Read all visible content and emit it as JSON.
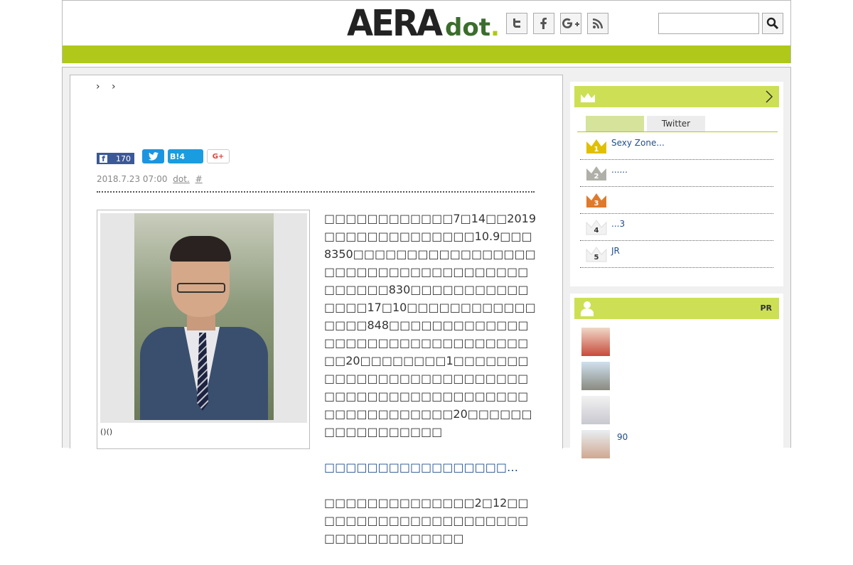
{
  "header": {
    "logo_main": "AERA",
    "logo_sub": "dot",
    "logo_period": ".",
    "sns": [
      "twitter-icon",
      "facebook-icon",
      "google-plus-icon",
      "rss-icon"
    ],
    "search_placeholder": ""
  },
  "article": {
    "breadcrumb": "› ›",
    "share": {
      "fb_count": "170",
      "hb_label": "B!",
      "hb_count": "4",
      "gp_label": "G+"
    },
    "date": "2018.7.23 07:00",
    "author": "dot.",
    "hash": "#",
    "photo_caption": "()()",
    "paragraphs": [
      "□□□□□□□□□□□□7□14□□2019□□□□□□□□□□□□□□10.9□□□8350□□□□□□□□□□□□□□□□□□□□□□□□□□□□□□□□□□□□□□□□□□830□□□□□□□□□□□□□□□17□10□□□□□□□□□□□□□□□□848□□□□□□□□□□□□□□□□□□□□□□□□□□□□□□□□□□20□□□□□□□□1□□□□□□□□□□□□□□□□□□□□□□□□□□□□□□□□□□□□□□□□□□□□□□□□□□□□□□□□□20□□□□□□□□□□□□□□□□□",
      "□□□□□□□□□□□□□□□□□…",
      "□□□□□□□□□□□□□□2□12□□□□□□□□□□□□□□□□□□□□□□□□□□□□□□□□□□"
    ]
  },
  "ranking": {
    "tabs": [
      "",
      "Twitter"
    ],
    "items": [
      {
        "rank": "1",
        "title": "Sexy Zone...",
        "color": "#e0c000"
      },
      {
        "rank": "2",
        "title": "......",
        "color": "#a9a9a9"
      },
      {
        "rank": "3",
        "title": "",
        "color": "#e07a2a"
      },
      {
        "rank": "4",
        "title": "...3",
        "color": "#ffffff"
      },
      {
        "rank": "5",
        "title": "JR",
        "color": "#ffffff"
      }
    ]
  },
  "pr": {
    "label": "PR",
    "items": [
      {
        "text": ""
      },
      {
        "text": ""
      },
      {
        "text": ""
      },
      {
        "text": "90"
      }
    ]
  }
}
